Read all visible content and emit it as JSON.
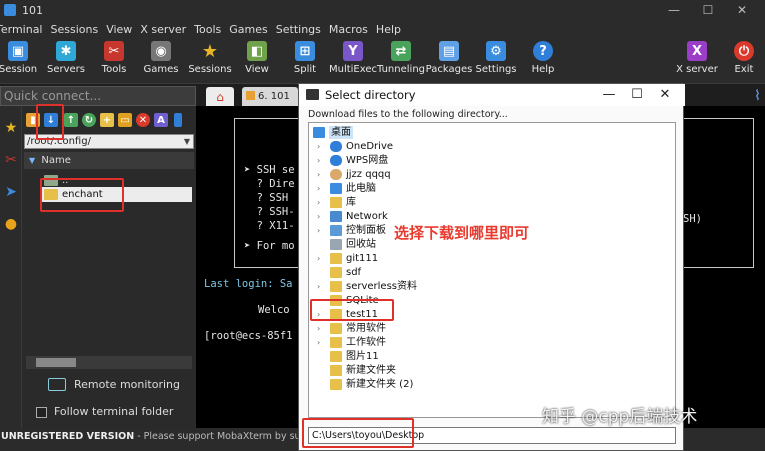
{
  "window": {
    "title": "101",
    "min": "—",
    "max": "☐",
    "close": "✕"
  },
  "menu": [
    "Terminal",
    "Sessions",
    "View",
    "X server",
    "Tools",
    "Games",
    "Settings",
    "Macros",
    "Help"
  ],
  "toolbar": [
    {
      "label": "Session",
      "icon": "session-icon",
      "color": "#3a8dde"
    },
    {
      "label": "Servers",
      "icon": "servers-icon",
      "color": "#2fa8d8"
    },
    {
      "label": "Tools",
      "icon": "tools-icon",
      "color": "#c8372e"
    },
    {
      "label": "Games",
      "icon": "games-icon",
      "color": "#777777"
    },
    {
      "label": "Sessions",
      "icon": "star-icon",
      "color": "#e8b624"
    },
    {
      "label": "View",
      "icon": "view-icon",
      "color": "#6fa24a"
    },
    {
      "label": "Split",
      "icon": "split-icon",
      "color": "#3a8dde"
    },
    {
      "label": "MultiExec",
      "icon": "multiexec-icon",
      "color": "#7a57c9"
    },
    {
      "label": "Tunneling",
      "icon": "tunneling-icon",
      "color": "#4aa35a"
    },
    {
      "label": "Packages",
      "icon": "packages-icon",
      "color": "#5fa0e6"
    },
    {
      "label": "Settings",
      "icon": "gear-icon",
      "color": "#3a8dde"
    },
    {
      "label": "Help",
      "icon": "help-icon",
      "color": "#2f7ed8"
    },
    {
      "label": "X server",
      "icon": "xserver-icon",
      "color": "#9a3ec8"
    },
    {
      "label": "Exit",
      "icon": "power-icon",
      "color": "#d93a2b"
    }
  ],
  "quick_connect": {
    "placeholder": "Quick connect..."
  },
  "tabs": {
    "session_label": "6. 101"
  },
  "sftp": {
    "path": "/root/.config/",
    "column_name": "Name",
    "files": [
      {
        "name": ".."
      },
      {
        "name": "enchant"
      }
    ],
    "remote_monitoring": "Remote monitoring",
    "follow_terminal": "Follow terminal folder"
  },
  "terminal": {
    "box_lines": [
      "➤ SSH se",
      "  ? Dire",
      "  ? SSH",
      "  ? SSH-",
      "  ? X11-",
      "",
      "➤ For mo"
    ],
    "box_right": "SH)",
    "last_login": "Last login: Sa",
    "welcome": "Welco",
    "prompt": "[root@ecs-85f1"
  },
  "status": {
    "unregistered": "UNREGISTERED VERSION",
    "message": " - Please support MobaXterm by subscribing"
  },
  "dialog": {
    "title": "Select directory",
    "description": "Download files to the following directory...",
    "nodes": [
      {
        "label": "桌面",
        "arrow": "",
        "icon": "desktop",
        "selected": true
      },
      {
        "label": "OneDrive",
        "arrow": "›",
        "icon": "cloud"
      },
      {
        "label": "WPS网盘",
        "arrow": "›",
        "icon": "cloud"
      },
      {
        "label": "jjzz qqqq",
        "arrow": "›",
        "icon": "user"
      },
      {
        "label": "此电脑",
        "arrow": "›",
        "icon": "pc"
      },
      {
        "label": "库",
        "arrow": "›",
        "icon": "folder"
      },
      {
        "label": "Network",
        "arrow": "›",
        "icon": "network"
      },
      {
        "label": "控制面板",
        "arrow": "›",
        "icon": "panel"
      },
      {
        "label": "回收站",
        "arrow": "",
        "icon": "recycle"
      },
      {
        "label": "git111",
        "arrow": "›",
        "icon": "folder"
      },
      {
        "label": "sdf",
        "arrow": "",
        "icon": "folder"
      },
      {
        "label": "serverless资料",
        "arrow": "›",
        "icon": "folder"
      },
      {
        "label": "SQLite",
        "arrow": "",
        "icon": "folder"
      },
      {
        "label": "test11",
        "arrow": "›",
        "icon": "folder"
      },
      {
        "label": "常用软件",
        "arrow": "›",
        "icon": "folder"
      },
      {
        "label": "工作软件",
        "arrow": "›",
        "icon": "folder"
      },
      {
        "label": "图片11",
        "arrow": "",
        "icon": "folder"
      },
      {
        "label": "新建文件夹",
        "arrow": "",
        "icon": "folder"
      },
      {
        "label": "新建文件夹 (2)",
        "arrow": "",
        "icon": "folder"
      }
    ],
    "path_value": "C:\\Users\\toyou\\Desktop"
  },
  "annotation": {
    "text": "选择下载到哪里即可",
    "color": "#e83a2f"
  },
  "watermark": "知乎 @cpp后端技术"
}
